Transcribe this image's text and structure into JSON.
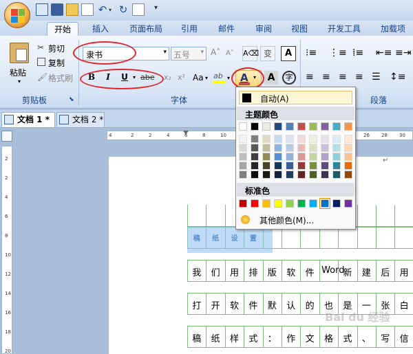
{
  "quick_access": {
    "icons": [
      "word-doc-icon",
      "save-icon",
      "open-icon",
      "new-icon",
      "undo-icon",
      "redo-icon",
      "print-preview-icon",
      "customize-icon"
    ]
  },
  "tabs": [
    "开始",
    "插入",
    "页面布局",
    "引用",
    "邮件",
    "审阅",
    "视图",
    "开发工具",
    "加载项"
  ],
  "clipboard": {
    "paste_label": "粘贴",
    "cut_label": "剪切",
    "copy_label": "复制",
    "format_painter_label": "格式刷",
    "group_label": "剪贴板"
  },
  "font": {
    "font_name": "隶书",
    "font_size": "五号",
    "group_label": "字体",
    "bold": "B",
    "italic": "I",
    "underline": "U",
    "strike": "abe",
    "case": "Aa",
    "font_color_glyph": "A",
    "char_border_glyph": "A",
    "phonetic_glyph": "变",
    "enclose_glyph": "字"
  },
  "paragraph": {
    "group_label": "段落"
  },
  "document_tabs": [
    "文档 1 *",
    "文档 2 *"
  ],
  "ruler_numbers": [
    "4",
    "2",
    "2",
    "4",
    "6",
    "8",
    "10",
    "12",
    "14",
    "16",
    "18",
    "20",
    "22",
    "24",
    "26",
    "28",
    "30"
  ],
  "vertical_ruler_numbers": [
    "2",
    "2",
    "4",
    "6",
    "8",
    "10",
    "12",
    "14",
    "16",
    "18",
    "20"
  ],
  "color_menu": {
    "auto_label": "自动(A)",
    "theme_heading": "主题颜色",
    "standard_heading": "标准色",
    "more_colors_label": "其他颜色(M)...",
    "theme_top": [
      "#ffffff",
      "#000000",
      "#eeece1",
      "#1f497d",
      "#4f81bd",
      "#c0504d",
      "#9bbb59",
      "#8064a2",
      "#4bacc6",
      "#f79646"
    ],
    "theme_shades": [
      [
        "#f2f2f2",
        "#d8d8d8",
        "#bfbfbf",
        "#a5a5a5",
        "#7f7f7f"
      ],
      [
        "#7f7f7f",
        "#595959",
        "#3f3f3f",
        "#262626",
        "#0c0c0c"
      ],
      [
        "#ddd9c3",
        "#c4bd97",
        "#938953",
        "#494429",
        "#1d1b10"
      ],
      [
        "#c6d9f0",
        "#8db3e2",
        "#548dd4",
        "#17365d",
        "#0f243e"
      ],
      [
        "#dbe5f1",
        "#b8cce4",
        "#95b3d7",
        "#366092",
        "#244061"
      ],
      [
        "#f2dcdb",
        "#e5b9b7",
        "#d99694",
        "#953734",
        "#632423"
      ],
      [
        "#ebf1dd",
        "#d7e3bc",
        "#c3d69b",
        "#76923c",
        "#4f6128"
      ],
      [
        "#e5e0ec",
        "#ccc1d9",
        "#b2a2c7",
        "#5f497a",
        "#3f3151"
      ],
      [
        "#dbeef3",
        "#b7dde8",
        "#92cddc",
        "#31859b",
        "#205867"
      ],
      [
        "#fdeada",
        "#fbd5b5",
        "#fac08f",
        "#e36c09",
        "#974806"
      ]
    ],
    "standard": [
      "#c00000",
      "#ff0000",
      "#ffc000",
      "#ffff00",
      "#92d050",
      "#00b050",
      "#00b0f0",
      "#0070c0",
      "#002060",
      "#7030a0"
    ]
  },
  "document": {
    "row1": [
      "稿",
      "纸",
      "设",
      "置"
    ],
    "row2": [
      "我",
      "们",
      "用",
      "排",
      "版",
      "软",
      "件",
      "Word",
      "新",
      "建",
      "后",
      "用"
    ],
    "row3": [
      "打",
      "开",
      "软",
      "件",
      "默",
      "认",
      "的",
      "也",
      "是",
      "一",
      "张",
      "白"
    ],
    "row4": [
      "稿",
      "纸",
      "样",
      "式",
      "：",
      "作",
      "文",
      "格",
      "式",
      "、",
      "写",
      "信"
    ]
  },
  "watermark": "Bai du 经验",
  "colors": {
    "annotation_red": "#e0262a",
    "grid_green": "#7ac07a",
    "ribbon_text": "#15428b",
    "font_color_bar": "#c0504d"
  }
}
